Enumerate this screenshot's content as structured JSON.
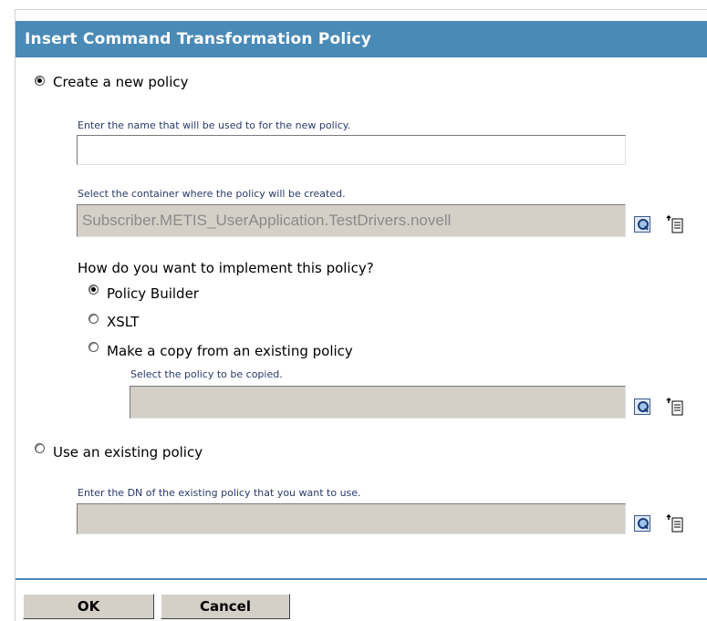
{
  "dialog": {
    "title": "Insert Command Transformation Policy"
  },
  "create_new": {
    "label": "Create a new policy",
    "selected": true,
    "name_hint": "Enter the name that will be used to for the new policy.",
    "name_value": "",
    "container_hint": "Select the container where the policy will be created.",
    "container_value": "Subscriber.METIS_UserApplication.TestDrivers.novell",
    "implement_question": "How do you want to implement this policy?",
    "options": [
      {
        "label": "Policy Builder",
        "selected": true
      },
      {
        "label": "XSLT",
        "selected": false
      },
      {
        "label": "Make a copy from an existing policy",
        "selected": false
      }
    ],
    "copy_hint": "Select the policy to be copied.",
    "copy_value": ""
  },
  "use_existing": {
    "label": "Use an existing policy",
    "selected": false,
    "dn_hint": "Enter the DN of the existing policy that you want to use.",
    "dn_value": ""
  },
  "buttons": {
    "ok": "OK",
    "cancel": "Cancel"
  },
  "icons": {
    "browse": "magnifier-icon",
    "history": "tree-history-icon"
  }
}
